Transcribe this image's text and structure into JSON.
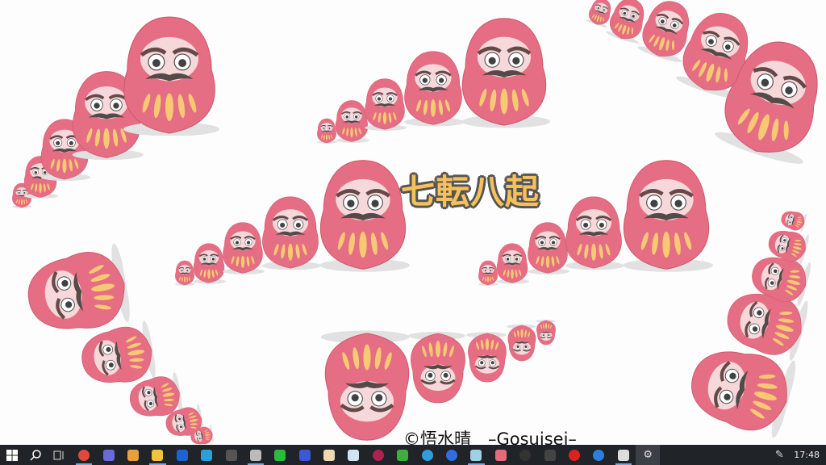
{
  "wallpaper": {
    "title": "七転八起",
    "credit": "©悟水晴　–Gosuisei–",
    "colors": {
      "body": "#e2566f",
      "face": "#f6d2d4",
      "gold": "#f6c15a"
    }
  },
  "taskbar": {
    "start": "start-button",
    "search": "search-button",
    "task_view": "task-view-button",
    "apps": [
      {
        "name": "chrome",
        "color": "#e04a3a",
        "open": true
      },
      {
        "name": "photos-app",
        "color": "#6a6ad8"
      },
      {
        "name": "media-player",
        "color": "#e8a13a"
      },
      {
        "name": "file-explorer",
        "color": "#f2c240",
        "open": true
      },
      {
        "name": "dropbox",
        "color": "#1e63d6"
      },
      {
        "name": "lightning-app",
        "color": "#2a9fd8"
      },
      {
        "name": "black-app",
        "color": "#555555"
      },
      {
        "name": "spiral-app",
        "color": "#bbbbbb",
        "open": true
      },
      {
        "name": "line",
        "color": "#2dbb3a"
      },
      {
        "name": "audio-app",
        "color": "#3a58d8"
      },
      {
        "name": "pet-app",
        "color": "#f0d9b0"
      },
      {
        "name": "m-app",
        "color": "#cfe6f2"
      },
      {
        "name": "music-disc",
        "color": "#b02050"
      },
      {
        "name": "music-note-app",
        "color": "#3fae3f"
      },
      {
        "name": "edge",
        "color": "#2f9fdc"
      },
      {
        "name": "zoom",
        "color": "#2f6fe0"
      },
      {
        "name": "notepad-app",
        "color": "#9ed0e6",
        "open": true
      },
      {
        "name": "paint-app",
        "color": "#e66a7a"
      },
      {
        "name": "obs",
        "color": "#333333"
      },
      {
        "name": "cap-app",
        "color": "#444444"
      },
      {
        "name": "record-app",
        "color": "#e02020"
      },
      {
        "name": "b-app",
        "color": "#2c7fe0"
      },
      {
        "name": "clip-app",
        "color": "#dddddd",
        "open": true
      },
      {
        "name": "settings",
        "color": "#dddddd",
        "active": true
      }
    ],
    "tray": {
      "pen_icon": "pen-icon",
      "clock": "17:48"
    }
  }
}
